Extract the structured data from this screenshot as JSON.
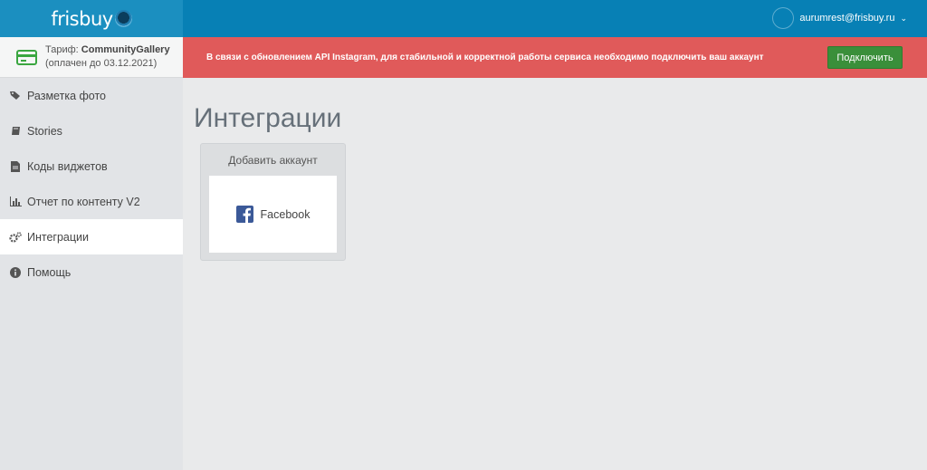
{
  "header": {
    "logo_text": "frisbuy",
    "user_email": "aurumrest@frisbuy.ru"
  },
  "tariff": {
    "label": "Тариф:",
    "plan": "CommunityGallery",
    "paid_until": "(оплачен до 03.12.2021)"
  },
  "sidebar": {
    "items": [
      {
        "label": "Разметка фото",
        "icon": "tags-icon"
      },
      {
        "label": "Stories",
        "icon": "book-icon"
      },
      {
        "label": "Коды виджетов",
        "icon": "file-icon"
      },
      {
        "label": "Отчет по контенту V2",
        "icon": "bar-chart-icon"
      },
      {
        "label": "Интеграции",
        "icon": "cogs-icon",
        "active": true
      },
      {
        "label": "Помощь",
        "icon": "info-icon"
      }
    ]
  },
  "banner": {
    "message": "В связи с обновлением API Instagram, для стабильной и корректной работы сервиса необходимо подключить ваш аккаунт",
    "button_label": "Подключить"
  },
  "main": {
    "title": "Интеграции",
    "panel_title": "Добавить аккаунт",
    "integration_label": "Facebook"
  },
  "colors": {
    "topbar": "#0780b5",
    "banner": "#e05a5a",
    "connect_button": "#3a8f3a",
    "facebook": "#3b5998"
  }
}
